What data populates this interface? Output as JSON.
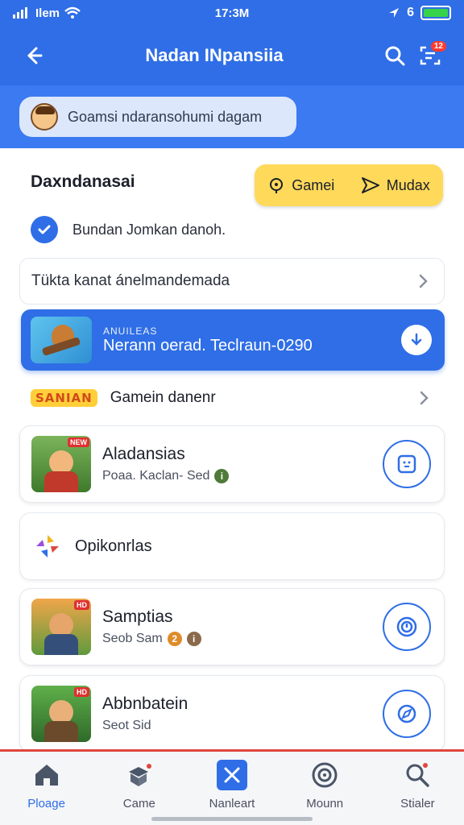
{
  "status_bar": {
    "carrier": "Ilem",
    "time": "17:3M",
    "battery_level": 1.0,
    "battery_color": "#36d34a"
  },
  "app_bar": {
    "title": "Nadan INpansiia",
    "notification_count": "12",
    "back_icon": "back-arrow-icon",
    "search_icon": "search-icon",
    "scan_icon": "scan-icon"
  },
  "search": {
    "text": "Goamsi ndaransohumi dagam"
  },
  "section": {
    "heading": "Daxndanasai",
    "chip_left": "Gamei",
    "chip_right": "Mudax",
    "chip_color": "#ffd95a"
  },
  "verified": {
    "text": "Bundan Jomkan danoh."
  },
  "link_row": {
    "label": "Tükta kanat ánelmandemada"
  },
  "promo": {
    "small_text": "ANUILEAS",
    "main_text": "Nerann oerad. Teclraun-0290",
    "color": "#2f6ee6"
  },
  "gamein": {
    "logo_text": "SANIAN",
    "label": "Gamein danenr"
  },
  "cards": [
    {
      "title": "Aladansias",
      "subtitle": "Poaa. Kaclan- Sed",
      "thumb_badge": "NEW",
      "info_color": "#4f7a3a",
      "action_icon": "app-frame-icon"
    },
    {
      "title": "Samptias",
      "subtitle": "Seob Sam",
      "thumb_badge": "HD",
      "info_color": "#e08a2a",
      "action_icon": "target-icon"
    },
    {
      "title": "Abbnbatein",
      "subtitle": "Seot Sid",
      "thumb_badge": "HD",
      "info_color": "#e08a2a",
      "action_icon": "compass-icon"
    }
  ],
  "optionals": {
    "label": "Opikonrlas"
  },
  "bottom_nav": [
    {
      "label": "Ploage",
      "icon": "home-icon",
      "active": true
    },
    {
      "label": "Came",
      "icon": "game-icon",
      "active": false
    },
    {
      "label": "Nanleart",
      "icon": "tools-icon",
      "active": false
    },
    {
      "label": "Mounn",
      "icon": "globe-icon",
      "active": false
    },
    {
      "label": "Stialer",
      "icon": "search-alert-icon",
      "active": false
    }
  ],
  "colors": {
    "primary": "#2f6ee6",
    "nav_border": "#e0463f"
  }
}
